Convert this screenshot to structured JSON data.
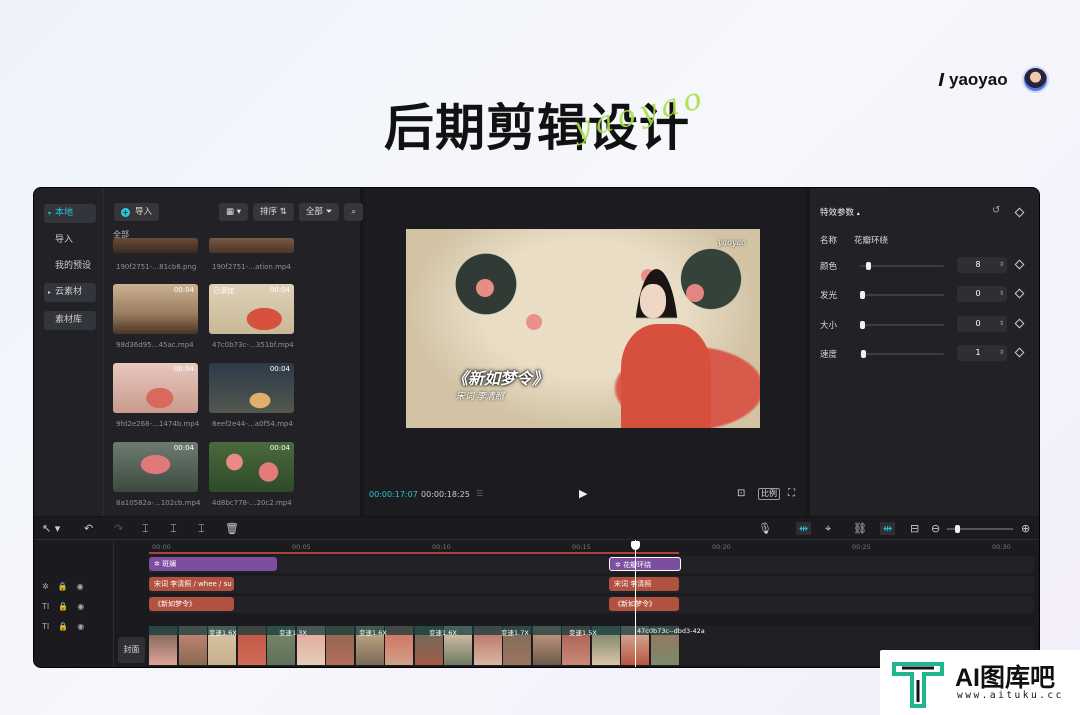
{
  "hero": {
    "title": "后期剪辑设计",
    "script": "yaoyao"
  },
  "brand": {
    "name": "yaoyao"
  },
  "nav": {
    "items": [
      "本地",
      "导入",
      "我的预设",
      "云素材",
      "素材库"
    ]
  },
  "library": {
    "import_label": "导入",
    "sort_label": "排序",
    "filter_label": "全部",
    "section_label": "全部",
    "items": [
      {
        "name": "190f2751-…81cb6.png",
        "duration": "",
        "badge": ""
      },
      {
        "name": "190f2751-…ation.mp4",
        "duration": "",
        "badge": ""
      },
      {
        "name": "98d36d95…45ac.mp4",
        "duration": "00:04",
        "badge": ""
      },
      {
        "name": "47c0b73c-…351bf.mp4",
        "duration": "00:04",
        "badge": "已添加"
      },
      {
        "name": "9fd2e268-…1474b.mp4",
        "duration": "00:04",
        "badge": ""
      },
      {
        "name": "8eef2e44-…a0f54.mp4",
        "duration": "00:04",
        "badge": ""
      },
      {
        "name": "8a10582a-…102cb.mp4",
        "duration": "00:04",
        "badge": ""
      },
      {
        "name": "4d8bc778-…20c2.mp4",
        "duration": "00:04",
        "badge": ""
      }
    ]
  },
  "player": {
    "watermark": "yaoyao",
    "poem_title": "《新如梦令》",
    "poem_sub": "宋词 李清照",
    "current_time": "00:00:17:07",
    "total_time": "00:00:18:25",
    "ratio_label": "比例"
  },
  "effect_panel": {
    "title": "特效参数",
    "name_label": "名称",
    "name_value": "花瓣环绕",
    "params": [
      {
        "label": "颜色",
        "value": "8",
        "level": 0.08
      },
      {
        "label": "发光",
        "value": "0",
        "level": 0
      },
      {
        "label": "大小",
        "value": "0",
        "level": 0
      },
      {
        "label": "速度",
        "value": "1",
        "level": 0.01
      }
    ]
  },
  "timeline": {
    "ticks": [
      "00:00",
      "00:05",
      "00:10",
      "00:15",
      "00:20",
      "00:25",
      "00:30"
    ],
    "effect_clips": [
      "斑斓",
      "花瓣环绕"
    ],
    "text_clips_1": [
      "宋词 李清照 / whee / su",
      "宋词 李清照"
    ],
    "text_clips_2": [
      "《新如梦令》",
      "《新如梦令》"
    ],
    "speed_labels": [
      "变速1.6X",
      "变速1.3X",
      "变速1.6X",
      "变速1.6X",
      "变速1.7X",
      "变速1.5X",
      "47c0b73c--dbd3-42a"
    ],
    "cover_label": "封面"
  },
  "logo": {
    "text": "AI图库吧",
    "url": "www.aituku.cc"
  }
}
